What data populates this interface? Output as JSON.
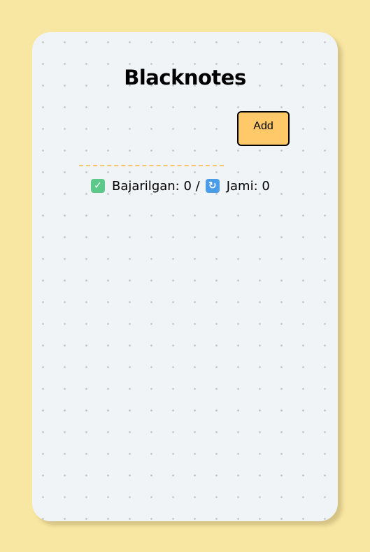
{
  "app": {
    "title": "Blacknotes"
  },
  "form": {
    "input_value": "",
    "input_placeholder": "",
    "add_label": "Add"
  },
  "stats": {
    "done_label": "Bajarilgan: 0 /",
    "total_label": "Jami: 0",
    "done_icon": "check-mark-button-icon",
    "total_icon": "counterclockwise-arrows-icon"
  },
  "colors": {
    "page_background": "#f8e7a2",
    "card_background": "#f1f4f7",
    "accent": "#ffc96a",
    "input_underline": "#f7c46b",
    "check_icon": "#5cc98a",
    "refresh_icon": "#4a9ce8"
  }
}
